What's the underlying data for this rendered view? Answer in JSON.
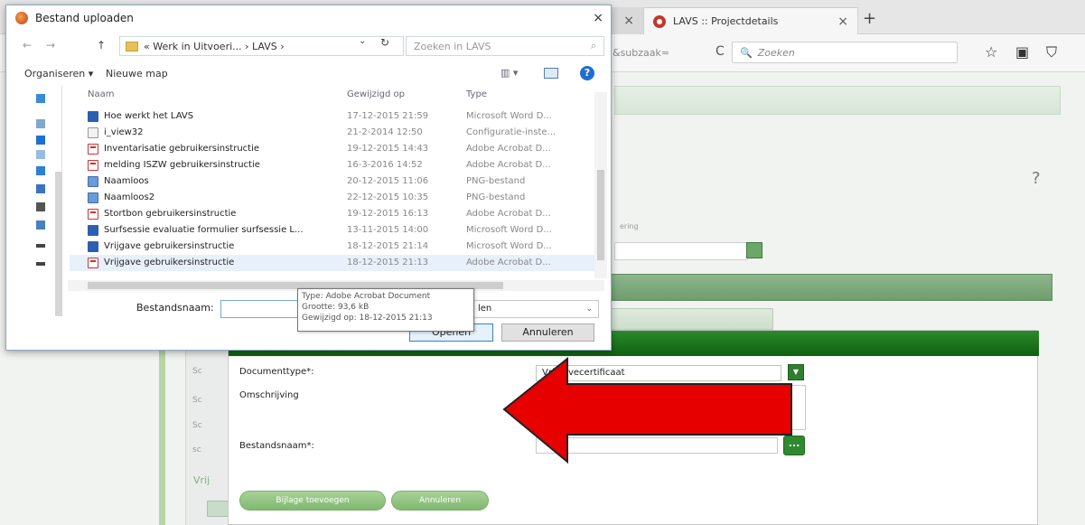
{
  "browser": {
    "prev_tab_close": "×",
    "active_tab_title": "LAVS :: Projectdetails",
    "active_tab_close": "×",
    "new_tab": "+",
    "url_partial": "&subzaak=",
    "reload": "C",
    "search_placeholder": "Zoeken",
    "search_glyph": "🔍"
  },
  "page": {
    "help": "?",
    "field_label": "ering",
    "inner_labels": [
      "Sc",
      "Sc",
      "Sc",
      "sc"
    ],
    "vrij": "Vrij",
    "modal": {
      "documenttype_label": "Documenttype*:",
      "documenttype_value": "Vrijgavecertificaat",
      "omschrijving_label": "Omschrijving",
      "bestandsnaam_label": "Bestandsnaam*:",
      "browse_label": "...",
      "btn_bijlage": "Bijlage toevoegen",
      "btn_annuleren": "Annuleren"
    }
  },
  "dialog": {
    "title": "Bestand uploaden",
    "close": "×",
    "nav_back": "←",
    "nav_forward": "→",
    "nav_up": "↑",
    "address": "« Werk in Uitvoeri... › LAVS ›",
    "search_placeholder": "Zoeken in LAVS",
    "search_glyph": "⌕",
    "organiseren": "Organiseren ▾",
    "nieuwe_map": "Nieuwe map",
    "view_toggle": "▥ ▾",
    "help": "?",
    "columns": {
      "name": "Naam",
      "date": "Gewijzigd op",
      "type": "Type"
    },
    "files": [
      {
        "name": "Hoe werkt het LAVS",
        "date": "17-12-2015 21:59",
        "type": "Microsoft Word D...",
        "icon": "word"
      },
      {
        "name": "i_view32",
        "date": "21-2-2014 12:50",
        "type": "Configuratie-inste...",
        "icon": "cfg"
      },
      {
        "name": "Inventarisatie gebruikersinstructie",
        "date": "19-12-2015 14:43",
        "type": "Adobe Acrobat D...",
        "icon": "pdf"
      },
      {
        "name": "melding ISZW gebruikersinstructie",
        "date": "16-3-2016 14:52",
        "type": "Adobe Acrobat D...",
        "icon": "pdf"
      },
      {
        "name": "Naamloos",
        "date": "20-12-2015 11:06",
        "type": "PNG-bestand",
        "icon": "png"
      },
      {
        "name": "Naamloos2",
        "date": "22-12-2015 10:35",
        "type": "PNG-bestand",
        "icon": "png"
      },
      {
        "name": "Stortbon gebruikersinstructie",
        "date": "19-12-2015 16:13",
        "type": "Adobe Acrobat D...",
        "icon": "pdf"
      },
      {
        "name": "Surfsessie evaluatie formulier surfsessie L...",
        "date": "13-11-2015 14:00",
        "type": "Microsoft Word D...",
        "icon": "word"
      },
      {
        "name": "Vrijgave gebruikersinstructie",
        "date": "18-12-2015 21:14",
        "type": "Microsoft Word D...",
        "icon": "word"
      },
      {
        "name": "Vrijgave gebruikersinstructie",
        "date": "18-12-2015 21:13",
        "type": "Adobe Acrobat D...",
        "icon": "pdf",
        "selected": true
      }
    ],
    "bestandsnaam_label": "Bestandsnaam:",
    "filter_value": "len",
    "btn_openen": "Openen",
    "btn_annuleren": "Annuleren",
    "tooltip": {
      "type": "Type: Adobe Acrobat Document",
      "size": "Grootte: 93,6 kB",
      "modified": "Gewijzigd op: 18-12-2015 21:13"
    }
  }
}
